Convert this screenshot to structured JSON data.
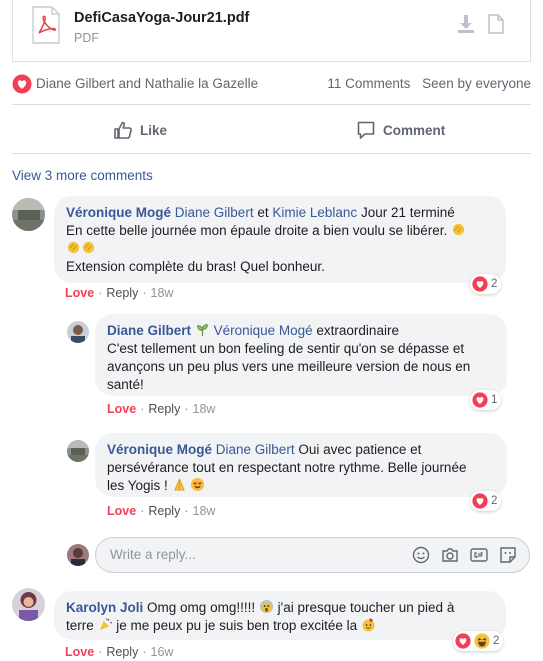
{
  "attachment": {
    "file_name": "DefiCasaYoga-Jour21.pdf",
    "file_type": "PDF",
    "download_icon": "download-icon",
    "document_icon": "document-icon"
  },
  "post_reactions": {
    "names": "Diane Gilbert and Nathalie la Gazelle",
    "comments_count": "11 Comments",
    "seen_by": "Seen by everyone"
  },
  "actions": {
    "like_label": "Like",
    "comment_label": "Comment"
  },
  "view_more": "View 3 more comments",
  "comments": [
    {
      "author": "Véronique Mogé",
      "tag1": "Diane Gilbert",
      "connector": "et",
      "tag2": "Kimie Leblanc",
      "line1": "Jour 21 terminé",
      "line2": "En cette belle journée mon épaule droite a bien voulu se libérer.",
      "line4": "Extension complète du bras! Quel bonheur.",
      "love": "Love",
      "reply": "Reply",
      "time": "18w",
      "reaction_count": "2",
      "replies": [
        {
          "author": "Diane Gilbert",
          "tag": "Véronique Mogé",
          "line1": "extraordinaire",
          "line2": "C'est tellement un bon feeling de sentir qu'on se dépasse et",
          "line3": "avançons un peu plus vers une meilleure version de nous en",
          "line4": "santé!",
          "love": "Love",
          "reply": "Reply",
          "time": "18w",
          "reaction_count": "1"
        },
        {
          "author": "Véronique Mogé",
          "tag": "Diane Gilbert",
          "line1": "Oui avec patience et",
          "line2": "persévérance tout en respectant notre rythme. Belle journée",
          "line3": "les Yogis !",
          "love": "Love",
          "reply": "Reply",
          "time": "18w",
          "reaction_count": "2"
        }
      ]
    },
    {
      "author": "Karolyn Joli",
      "line1": "Omg omg omg!!!!!",
      "line1b": "j'ai presque toucher un pied à",
      "line2a": "terre",
      "line2b": "je me peux pu je suis ben trop excitée la",
      "love": "Love",
      "reply": "Reply",
      "time": "16w",
      "reaction_count": "2"
    }
  ],
  "reply_box": {
    "placeholder": "Write a reply..."
  },
  "colors": {
    "link": "#385898",
    "love": "#f33e58",
    "bubble": "#f2f3f5",
    "muted": "#90949c"
  }
}
